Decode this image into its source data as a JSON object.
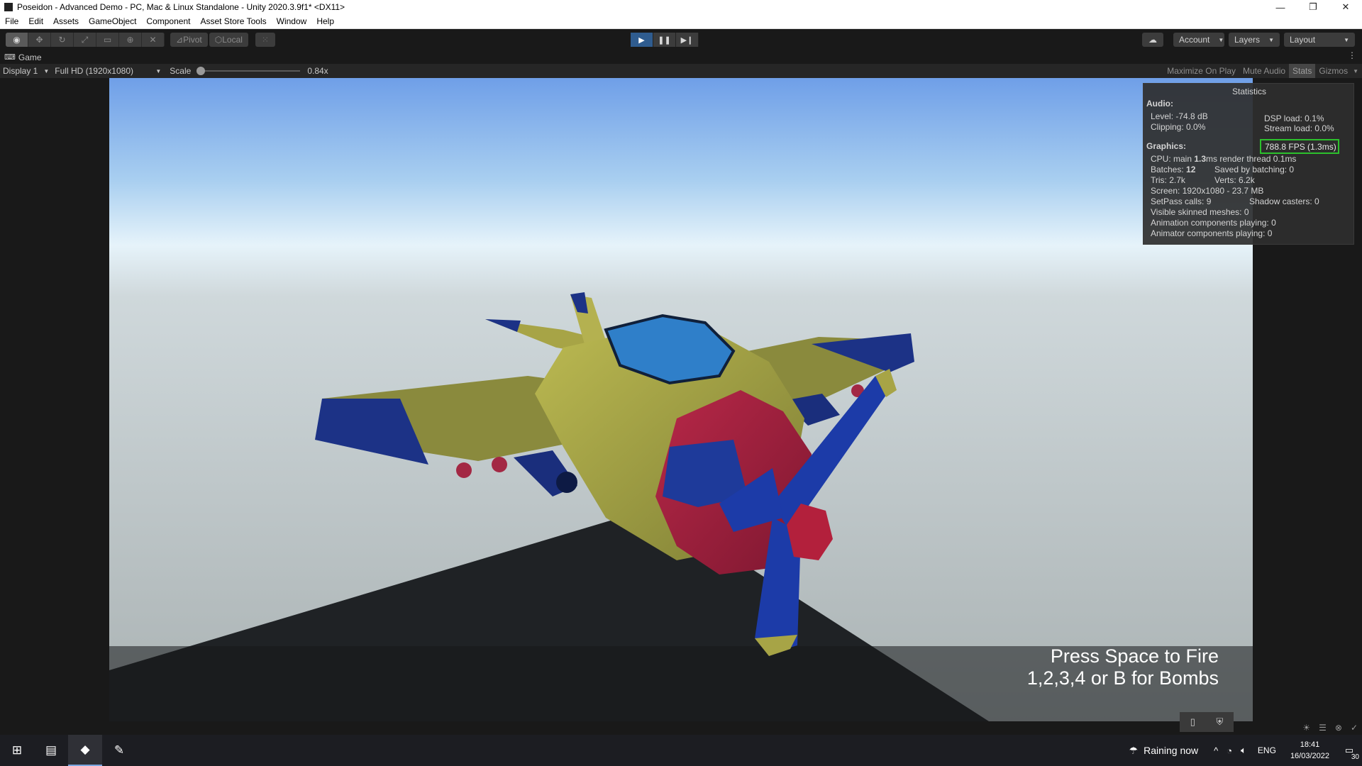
{
  "window": {
    "title": "Poseidon - Advanced Demo - PC, Mac & Linux Standalone - Unity 2020.3.9f1* <DX11>",
    "minimize": "—",
    "restore": "❐",
    "close": "✕"
  },
  "menu": {
    "items": [
      "File",
      "Edit",
      "Assets",
      "GameObject",
      "Component",
      "Asset Store Tools",
      "Window",
      "Help"
    ]
  },
  "toolbar": {
    "pivot": "Pivot",
    "local": "Local",
    "account": "Account",
    "layers": "Layers",
    "layout": "Layout",
    "play_state": "playing"
  },
  "game_tab": {
    "label": "Game"
  },
  "game_bar": {
    "display": "Display 1",
    "resolution": "Full HD (1920x1080)",
    "scale_label": "Scale",
    "scale_value": "0.84x",
    "maximize": "Maximize On Play",
    "mute": "Mute Audio",
    "stats": "Stats",
    "gizmos": "Gizmos"
  },
  "stats": {
    "title": "Statistics",
    "audio_heading": "Audio:",
    "level": "Level: -74.8 dB",
    "clipping": "Clipping: 0.0%",
    "dsp": "DSP load: 0.1%",
    "stream": "Stream load: 0.0%",
    "graphics_heading": "Graphics:",
    "fps": "788.8 FPS (1.3ms)",
    "cpu_prefix": "CPU: main",
    "cpu_value": "1.3",
    "cpu_suffix": "ms  render thread 0.1ms",
    "batches_prefix": "Batches:",
    "batches_value": "12",
    "saved": "Saved by batching: 0",
    "tris": "Tris: 2.7k",
    "verts": "Verts: 6.2k",
    "screen": "Screen: 1920x1080 - 23.7 MB",
    "setpass": "SetPass calls: 9",
    "shadow": "Shadow casters: 0",
    "skinned": "Visible skinned meshes: 0",
    "animation": "Animation components playing: 0",
    "animator": "Animator components playing: 0"
  },
  "overlay": {
    "line1": "Press Space to Fire",
    "line2": "1,2,3,4 or B for Bombs"
  },
  "taskbar": {
    "weather": "Raining now",
    "lang": "ENG",
    "time": "18:41",
    "date": "16/03/2022",
    "notifications": "30"
  },
  "colors": {
    "sky_top": "#6f9fe8",
    "sky_mid": "#d8ecf7",
    "ground": "#b8bdbe",
    "plane_body": "#a7a446",
    "plane_blue": "#1f3a8f",
    "plane_red": "#a3203c",
    "canopy": "#2f7fc9",
    "fps_highlight": "#2cc02c",
    "play_active": "#2f5c8f"
  }
}
